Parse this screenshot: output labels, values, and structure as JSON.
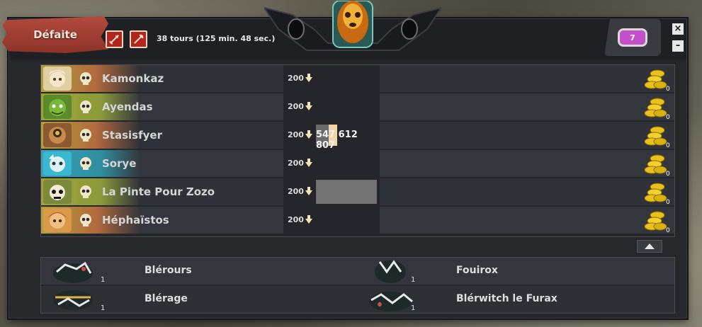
{
  "header": {
    "title": "Défaite",
    "turns_text": "38 tours (125 min. 48 sec.)",
    "kama_value": "7",
    "close_label": "×",
    "minimize_label": "–"
  },
  "players": [
    {
      "name": "Kamonkaz",
      "level": "200",
      "xp_text": "",
      "kamas": "0",
      "variant": "plain"
    },
    {
      "name": "Ayendas",
      "level": "200",
      "xp_text": "",
      "kamas": "0",
      "variant": "plain"
    },
    {
      "name": "Stasisfyer",
      "level": "200",
      "xp_text": "547 612 807",
      "kamas": "0",
      "variant": "highlight"
    },
    {
      "name": "Sorye",
      "level": "200",
      "xp_text": "",
      "kamas": "0",
      "variant": "plain"
    },
    {
      "name": "La Pinte Pour Zozo",
      "level": "200",
      "xp_text": "",
      "kamas": "0",
      "variant": "grey"
    },
    {
      "name": "Héphaïstos",
      "level": "200",
      "xp_text": "",
      "kamas": "0",
      "variant": "plain"
    }
  ],
  "monsters": [
    {
      "name": "Blérours",
      "count": "1"
    },
    {
      "name": "Fouirox",
      "count": "1"
    },
    {
      "name": "Blérage",
      "count": "1"
    },
    {
      "name": "Blérwitch le Furax",
      "count": "1"
    }
  ],
  "colors": {
    "title_banner": "#b24a3e",
    "kama_gem": "#c44fc9",
    "coin": "#e8c21a",
    "highlight": "#f1d6a9"
  }
}
